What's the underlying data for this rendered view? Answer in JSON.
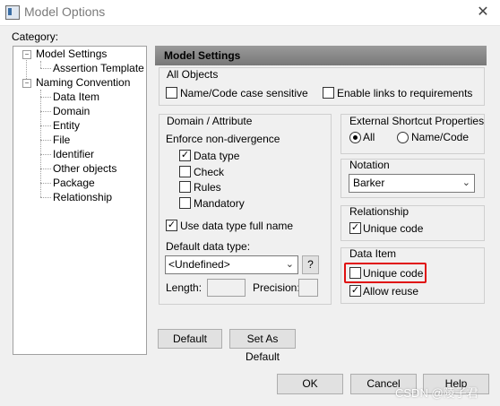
{
  "window": {
    "title": "Model Options",
    "close_glyph": "✕"
  },
  "category": {
    "label": "Category:",
    "tree": [
      {
        "label": "Model Settings"
      },
      {
        "label": "Assertion Template"
      },
      {
        "label": "Naming Convention"
      },
      {
        "label": "Data Item"
      },
      {
        "label": "Domain"
      },
      {
        "label": "Entity"
      },
      {
        "label": "File"
      },
      {
        "label": "Identifier"
      },
      {
        "label": "Other objects"
      },
      {
        "label": "Package"
      },
      {
        "label": "Relationship"
      }
    ]
  },
  "main": {
    "header": "Model Settings",
    "all_objects": {
      "title": "All Objects",
      "name_code_case": {
        "label": "Name/Code case sensitive",
        "checked": false
      },
      "enable_links": {
        "label": "Enable links to requirements",
        "checked": false
      }
    },
    "domain_attribute": {
      "title": "Domain / Attribute",
      "enforce_label": "Enforce non-divergence",
      "data_type": {
        "label": "Data type",
        "checked": true
      },
      "check": {
        "label": "Check",
        "checked": false
      },
      "rules": {
        "label": "Rules",
        "checked": false
      },
      "mandatory": {
        "label": "Mandatory",
        "checked": false
      },
      "use_full_name": {
        "label": "Use data type full name",
        "checked": true
      },
      "default_type_label": "Default data type:",
      "default_type_value": "<Undefined>",
      "help_button": "?",
      "length_label": "Length:",
      "precision_label": "Precision:"
    },
    "external_shortcut": {
      "title": "External Shortcut Properties",
      "all": {
        "label": "All",
        "selected": true
      },
      "name_code": {
        "label": "Name/Code",
        "selected": false
      }
    },
    "notation": {
      "title": "Notation",
      "value": "Barker"
    },
    "relationship": {
      "title": "Relationship",
      "unique_code": {
        "label": "Unique code",
        "checked": true
      }
    },
    "data_item": {
      "title": "Data Item",
      "unique_code": {
        "label": "Unique code",
        "checked": false
      },
      "allow_reuse": {
        "label": "Allow reuse",
        "checked": true
      }
    },
    "default_button": "Default",
    "set_default_button": "Set As Default"
  },
  "footer": {
    "ok": "OK",
    "cancel": "Cancel",
    "help": "Help"
  },
  "watermark": "CSDN @陵子君",
  "colors": {
    "highlight": "#e01010",
    "header_band": "#8a8a8a"
  }
}
